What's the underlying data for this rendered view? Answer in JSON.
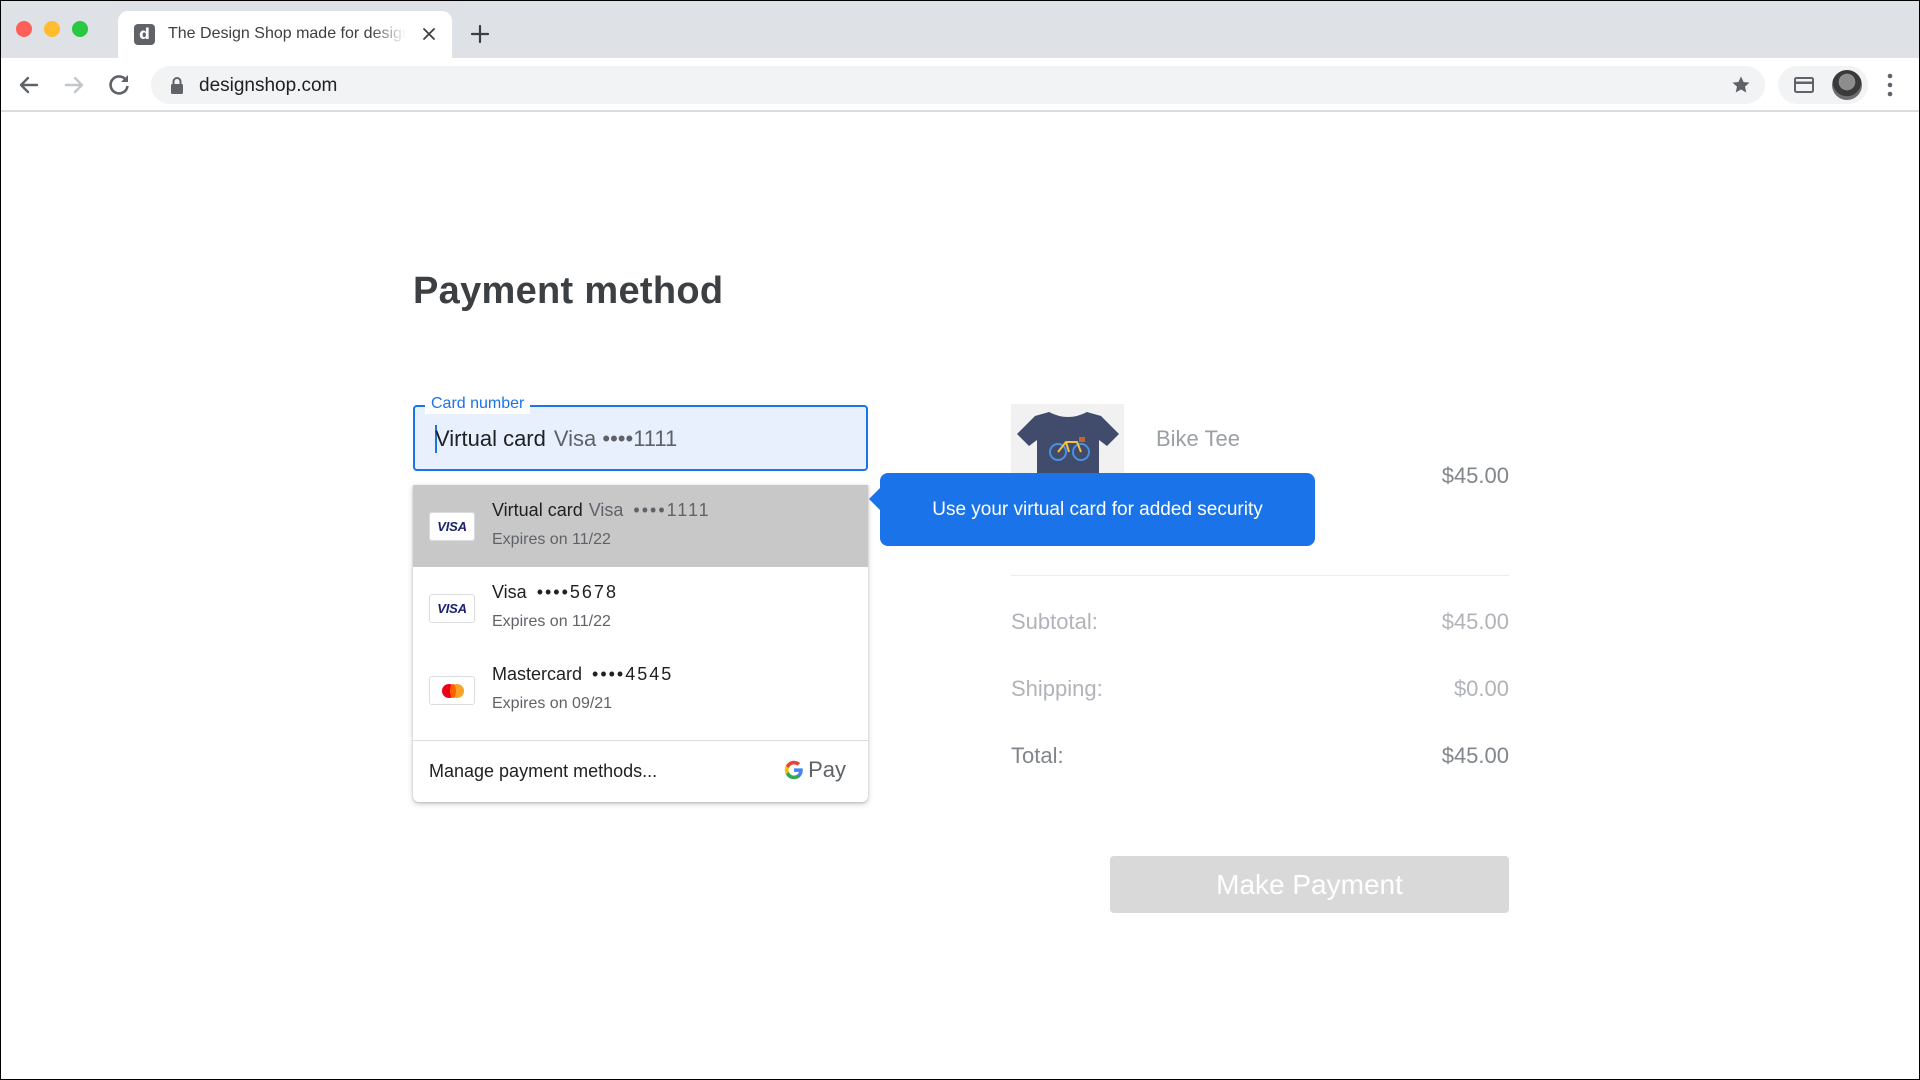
{
  "browser": {
    "tab": {
      "favicon_letter": "d",
      "title": "The Design Shop made for designers"
    },
    "url": "designshop.com"
  },
  "page": {
    "title": "Payment method",
    "card_field": {
      "label": "Card number",
      "value_primary": "Virtual card",
      "value_secondary": "Visa ••••1111"
    },
    "dropdown": {
      "items": [
        {
          "brand": "VISA",
          "name": "Virtual card",
          "network": "Visa",
          "masked": "••••1111",
          "expiry": "Expires on 11/22",
          "selected": true
        },
        {
          "brand": "VISA",
          "name": "Visa",
          "masked": "••••5678",
          "expiry": "Expires on 11/22",
          "selected": false
        },
        {
          "brand": "mastercard",
          "name": "Mastercard",
          "masked": "••••4545",
          "expiry": "Expires on 09/21",
          "selected": false
        }
      ],
      "manage_label": "Manage payment methods...",
      "gpay_label": "Pay"
    },
    "tooltip": "Use your virtual card for added security",
    "order": {
      "product_name": "Bike Tee",
      "product_price": "$45.00",
      "subtotal_label": "Subtotal:",
      "subtotal_value": "$45.00",
      "shipping_label": "Shipping:",
      "shipping_value": "$0.00",
      "total_label": "Total:",
      "total_value": "$45.00"
    },
    "pay_button": "Make Payment"
  },
  "colors": {
    "accent": "#1a73e8",
    "field_bg": "#e8f0fe",
    "selected_row": "#c8c8c8",
    "button_disabled": "#d9d9d9"
  }
}
